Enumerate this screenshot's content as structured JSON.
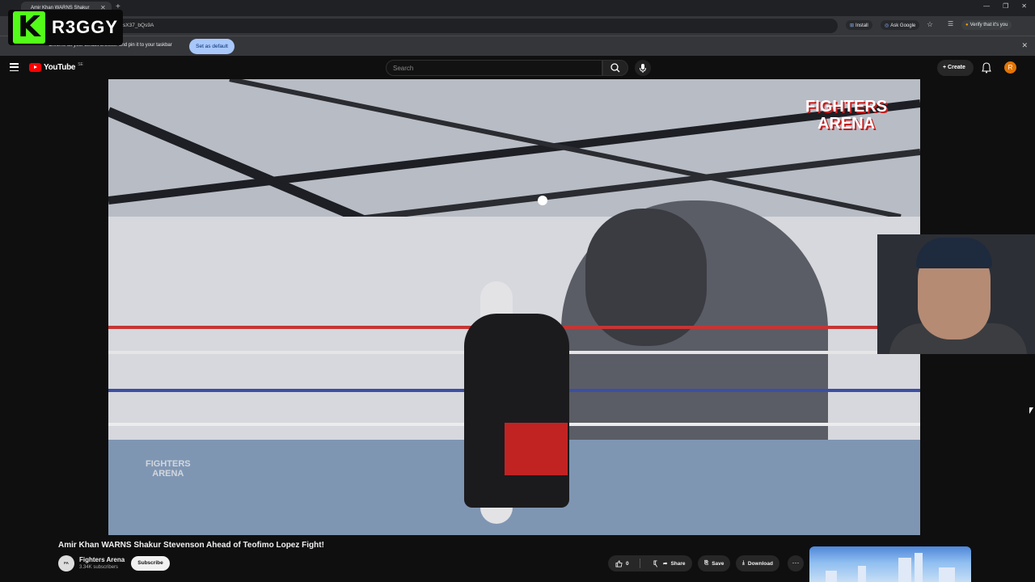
{
  "browser": {
    "tab_title": "Amir Khan WARNS Shakur",
    "url": "sX37_bQs9A",
    "install_label": "Install",
    "ask_google_label": "Ask Google",
    "verify_label": "Verify that it's you",
    "infobar_text": "Chrome as your default browser and pin it to your taskbar",
    "set_default_label": "Set as default"
  },
  "overlay": {
    "logo_letter": "K",
    "streamer_name": "R3GGY"
  },
  "youtube": {
    "logo_text": "YouTube",
    "region": "SE",
    "search_placeholder": "Search",
    "create_label": "Create",
    "avatar_letter": "R"
  },
  "video": {
    "watermark_line1": "FIGHTERS",
    "watermark_line2": "ARENA",
    "watermark_small_line1": "FIGHTERS",
    "watermark_small_line2": "ARENA",
    "title": "Amir Khan WARNS Shakur Stevenson Ahead of Teofimo Lopez Fight!",
    "channel_name": "Fighters Arena",
    "subscribers": "3.34K subscribers",
    "subscribe_label": "Subscribe",
    "like_count": "0",
    "share_label": "Share",
    "save_label": "Save",
    "download_label": "Download"
  },
  "colors": {
    "youtube_red": "#ff0000",
    "kick_green": "#53fc18",
    "avatar_orange": "#e37400"
  }
}
